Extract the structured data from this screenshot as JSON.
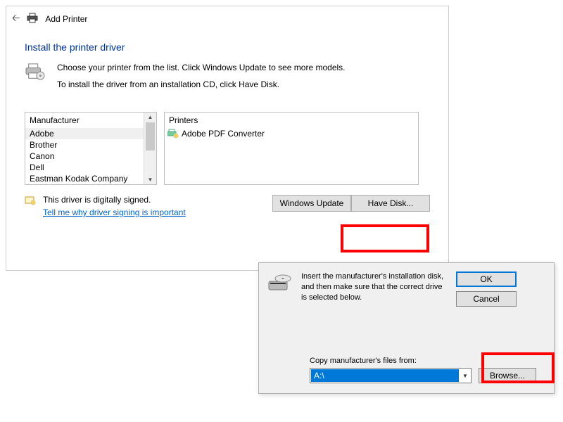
{
  "main": {
    "title": "Add Printer",
    "heading": "Install the printer driver",
    "instruction1": "Choose your printer from the list. Click Windows Update to see more models.",
    "instruction2": "To install the driver from an installation CD, click Have Disk.",
    "manufacturer_header": "Manufacturer",
    "printers_header": "Printers",
    "manufacturers": [
      "Adobe",
      "Brother",
      "Canon",
      "Dell",
      "Eastman Kodak Company"
    ],
    "printers": [
      "Adobe PDF Converter"
    ],
    "signed_text": "This driver is digitally signed.",
    "signing_link": "Tell me why driver signing is important",
    "windows_update_btn": "Windows Update",
    "have_disk_btn": "Have Disk..."
  },
  "sub": {
    "instruction": "Insert the manufacturer's installation disk, and then make sure that the correct drive is selected below.",
    "ok_btn": "OK",
    "cancel_btn": "Cancel",
    "copy_label": "Copy manufacturer's files from:",
    "path_value": "A:\\",
    "browse_btn": "Browse..."
  }
}
